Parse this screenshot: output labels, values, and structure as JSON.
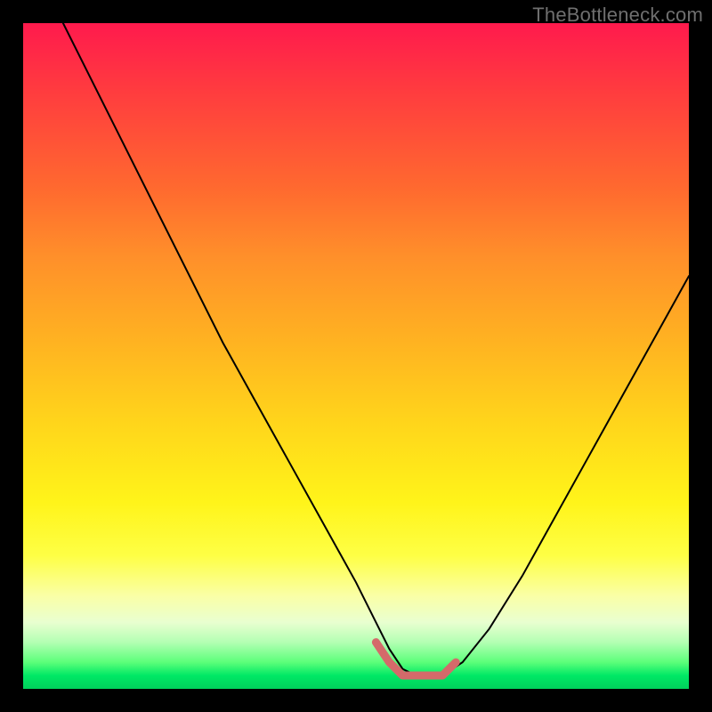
{
  "watermark": "TheBottleneck.com",
  "chart_data": {
    "type": "line",
    "title": "",
    "xlabel": "",
    "ylabel": "",
    "xlim": [
      0,
      100
    ],
    "ylim": [
      0,
      100
    ],
    "grid": false,
    "legend": false,
    "series": [
      {
        "name": "main-curve",
        "color": "#000000",
        "x": [
          6,
          10,
          15,
          20,
          25,
          30,
          35,
          40,
          45,
          50,
          53,
          55,
          57,
          59,
          61,
          63,
          66,
          70,
          75,
          80,
          85,
          90,
          95,
          100
        ],
        "y": [
          100,
          92,
          82,
          72,
          62,
          52,
          43,
          34,
          25,
          16,
          10,
          6,
          3,
          2,
          2,
          2,
          4,
          9,
          17,
          26,
          35,
          44,
          53,
          62
        ]
      },
      {
        "name": "bottom-highlight",
        "color": "#d46a6a",
        "x": [
          53,
          55,
          57,
          59,
          61,
          63,
          65
        ],
        "y": [
          7,
          4,
          2,
          2,
          2,
          2,
          4
        ]
      }
    ],
    "background_gradient": {
      "stops": [
        {
          "pos": 0.0,
          "color": "#ff1a4d"
        },
        {
          "pos": 0.1,
          "color": "#ff3b3f"
        },
        {
          "pos": 0.25,
          "color": "#ff6a2f"
        },
        {
          "pos": 0.35,
          "color": "#ff8f2a"
        },
        {
          "pos": 0.48,
          "color": "#ffb321"
        },
        {
          "pos": 0.6,
          "color": "#ffd51b"
        },
        {
          "pos": 0.72,
          "color": "#fff41a"
        },
        {
          "pos": 0.8,
          "color": "#feff45"
        },
        {
          "pos": 0.86,
          "color": "#faffa6"
        },
        {
          "pos": 0.9,
          "color": "#e9ffd0"
        },
        {
          "pos": 0.93,
          "color": "#b3ffb3"
        },
        {
          "pos": 0.96,
          "color": "#5cff7a"
        },
        {
          "pos": 0.98,
          "color": "#00e865"
        },
        {
          "pos": 1.0,
          "color": "#00d15c"
        }
      ]
    }
  }
}
